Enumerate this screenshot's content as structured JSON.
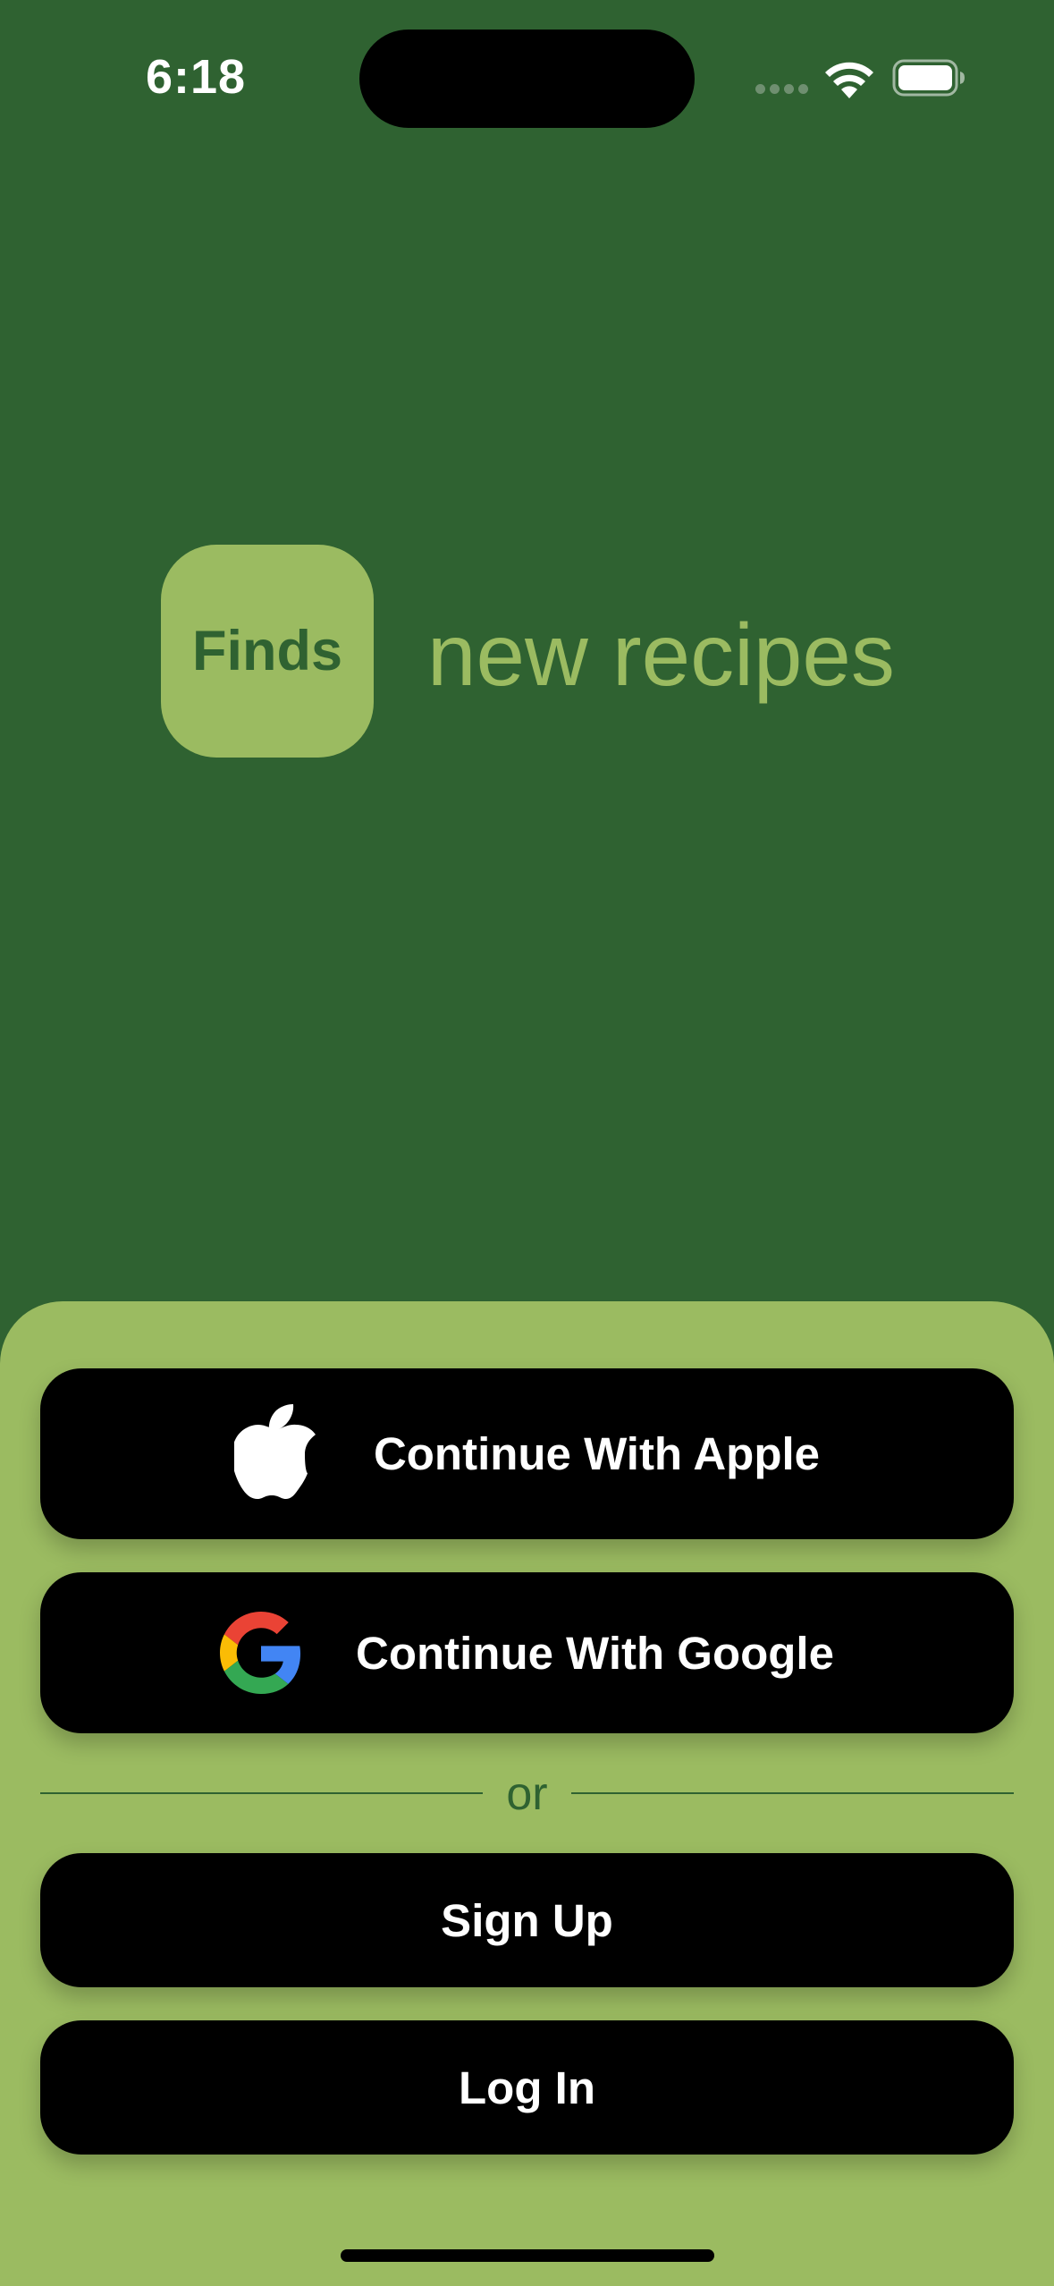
{
  "status_bar": {
    "time": "6:18",
    "icons": [
      "signal-icon",
      "wifi-icon",
      "battery-icon"
    ]
  },
  "brand": {
    "logo_text": "Finds",
    "tagline": "new recipes"
  },
  "auth": {
    "apple_label": "Continue With Apple",
    "google_label": "Continue With Google",
    "divider_text": "or",
    "signup_label": "Sign Up",
    "login_label": "Log In"
  },
  "colors": {
    "background": "#2F6231",
    "accent": "#9BBB61",
    "button": "#000000",
    "button_text": "#FFFFFF"
  }
}
